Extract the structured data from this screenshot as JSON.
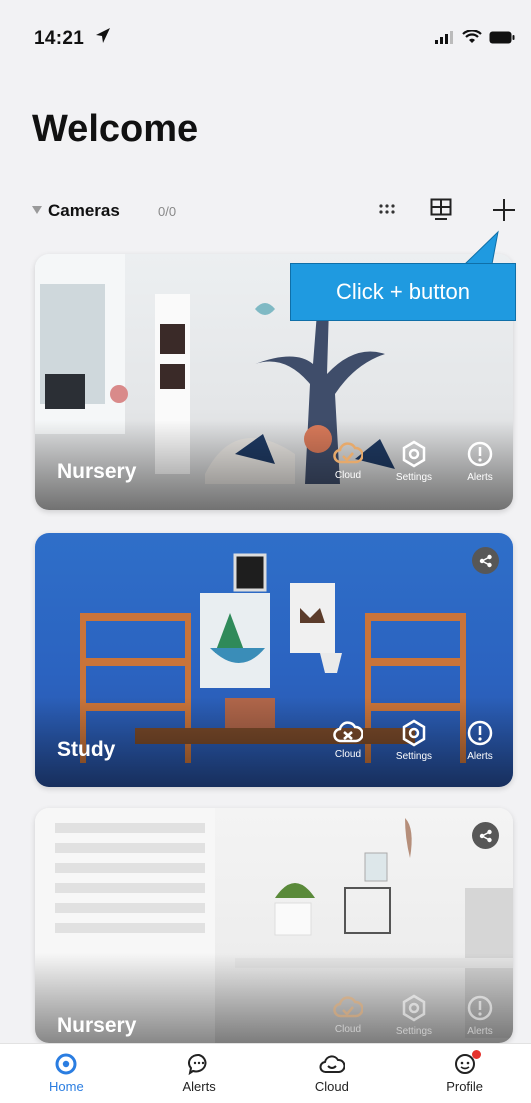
{
  "status_bar": {
    "time": "14:21"
  },
  "page": {
    "title": "Welcome"
  },
  "cameras_section": {
    "label": "Cameras",
    "count": "0/0"
  },
  "callout": {
    "text": "Click + button"
  },
  "cameras": [
    {
      "name": "Nursery",
      "cloud_label": "Cloud",
      "settings_label": "Settings",
      "alerts_label": "Alerts",
      "cloud_state": "active"
    },
    {
      "name": "Study",
      "cloud_label": "Cloud",
      "settings_label": "Settings",
      "alerts_label": "Alerts",
      "cloud_state": "off",
      "shared": true
    },
    {
      "name": "Nursery",
      "cloud_label": "Cloud",
      "settings_label": "Settings",
      "alerts_label": "Alerts",
      "cloud_state": "active",
      "shared": true
    }
  ],
  "tabs": [
    {
      "label": "Home",
      "icon": "home-icon",
      "active": true
    },
    {
      "label": "Alerts",
      "icon": "chat-bubble-icon"
    },
    {
      "label": "Cloud",
      "icon": "cloud-icon"
    },
    {
      "label": "Profile",
      "icon": "profile-icon",
      "badge": true
    }
  ],
  "colors": {
    "accent": "#2a7de1",
    "callout": "#1f9ae0",
    "cloud_active": "#e6a96b",
    "badge": "#e5322d"
  }
}
